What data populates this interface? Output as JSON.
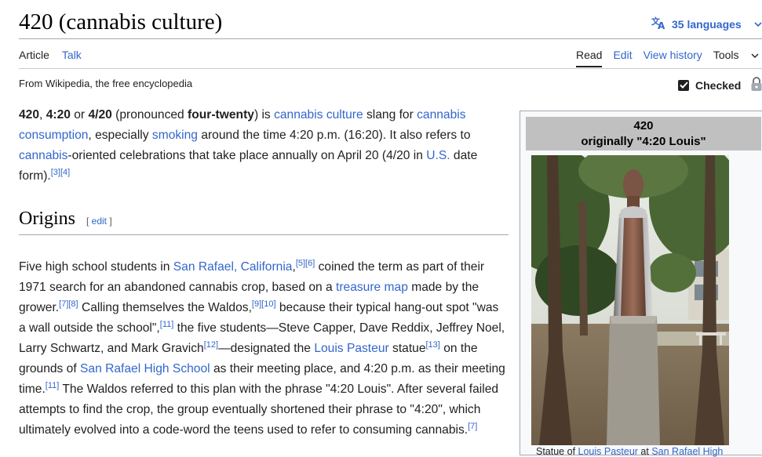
{
  "page": {
    "title": "420 (cannabis culture)",
    "languages_label": "35 languages",
    "tagline": "From Wikipedia, the free encyclopedia",
    "checked_label": "Checked"
  },
  "tabs": {
    "article": "Article",
    "talk": "Talk",
    "read": "Read",
    "edit": "Edit",
    "history": "View history",
    "tools": "Tools"
  },
  "intro": {
    "b1": "420",
    "t1": ", ",
    "b2": "4:20",
    "t2": " or ",
    "b3": "4/20",
    "t3": " (pronounced ",
    "b4": "four-twenty",
    "t4": ") is ",
    "l1": "cannabis culture",
    "t5": " slang for ",
    "l2": "cannabis consumption",
    "t6": ", especially ",
    "l3": "smoking",
    "t7": " around the time 4:20 p.m. (16:20). It also refers to ",
    "l4": "cannabis",
    "t8": "-oriented celebrations that take place annually on April 20 (4/20 in ",
    "l5": "U.S.",
    "t9": " date form).",
    "r1": "[3]",
    "r2": "[4]"
  },
  "origins": {
    "heading": "Origins",
    "edit_open": "[ ",
    "edit_label": "edit",
    "edit_close": " ]",
    "t1": "Five high school students in ",
    "l1": "San Rafael, California",
    "t1b": ",",
    "r5": "[5]",
    "r6": "[6]",
    "t2": " coined the term as part of their 1971 search for an abandoned cannabis crop, based on a ",
    "l2": "treasure map",
    "t3": " made by the grower.",
    "r7": "[7]",
    "r8": "[8]",
    "t4": " Calling themselves the Waldos,",
    "r9": "[9]",
    "r10": "[10]",
    "t5": " because their typical hang-out spot \"was a wall outside the school\",",
    "r11": "[11]",
    "t6": " the five students—Steve Capper, Dave Reddix, Jeffrey Noel, Larry Schwartz, and Mark Gravich",
    "r12": "[12]",
    "t7": "—designated the ",
    "l3": "Louis Pasteur",
    "t8": " statue",
    "r13": "[13]",
    "t9": " on the grounds of ",
    "l4": "San Rafael High School",
    "t10": " as their meeting place, and 4:20 p.m. as their meeting time.",
    "r11b": "[11]",
    "t11": " The Waldos referred to this plan with the phrase \"4:20 Louis\". After several failed attempts to find the crop, the group eventually shortened their phrase to \"4:20\", which ultimately evolved into a code-word the teens used to refer to consuming cannabis.",
    "r7b": "[7]"
  },
  "infobox": {
    "title": "420",
    "subtitle": "originally \"4:20 Louis\"",
    "caption_t1": "Statue of ",
    "caption_l1": "Louis Pasteur",
    "caption_t2": " at ",
    "caption_l2": "San Rafael High"
  },
  "colors": {
    "link": "#3366cc",
    "text": "#202122",
    "infobox_header": "#c0c0c0",
    "border": "#a2a9b1"
  },
  "icons": [
    "translate-icon",
    "chevron-down-icon",
    "checkbox-icon",
    "lock-icon"
  ]
}
